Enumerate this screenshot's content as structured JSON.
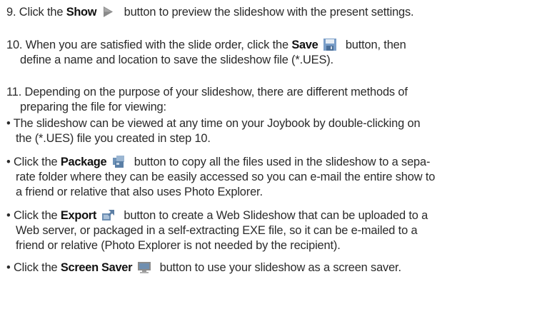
{
  "steps": [
    {
      "number": "9.",
      "before": "Click the",
      "keyword": "Show",
      "icon": "play-icon",
      "after": "button to preview the slideshow with the present settings."
    },
    {
      "number": "10.",
      "before": "When you are satisfied with the slide order, click the",
      "keyword": "Save",
      "icon": "save-icon",
      "after_line1": "button, then",
      "line2": "define a name and location to save the slideshow file (*.UES)."
    },
    {
      "number": "11.",
      "line1": "Depending on the purpose of your slideshow, there are different methods of",
      "line2": "preparing the file for viewing:"
    }
  ],
  "bullets": [
    {
      "marker": "•",
      "line1": "The slideshow can be viewed at any time on your Joybook by double-clicking on",
      "line2": "the (*.UES) file you created in step 10."
    },
    {
      "marker": "•",
      "before": "Click the",
      "keyword": "Package",
      "icon": "package-icon",
      "after_line1": "button to copy all the files used in the slideshow to a sepa-",
      "line2": "rate folder where they can be easily accessed so you can e-mail the entire show to",
      "line3": "a friend or relative that also uses Photo Explorer."
    },
    {
      "marker": "•",
      "before": "Click the",
      "keyword": "Export",
      "icon": "export-icon",
      "after_line1": "button to create a Web Slideshow that can be uploaded to a",
      "line2": "Web server, or packaged in a self-extracting EXE file, so it can be e-mailed to a",
      "line3": "friend or relative (Photo Explorer is not needed by the recipient)."
    },
    {
      "marker": "•",
      "before": "Click the",
      "keyword": "Screen Saver",
      "icon": "monitor-icon",
      "after_line1": "button to use your slideshow as a screen saver."
    }
  ]
}
